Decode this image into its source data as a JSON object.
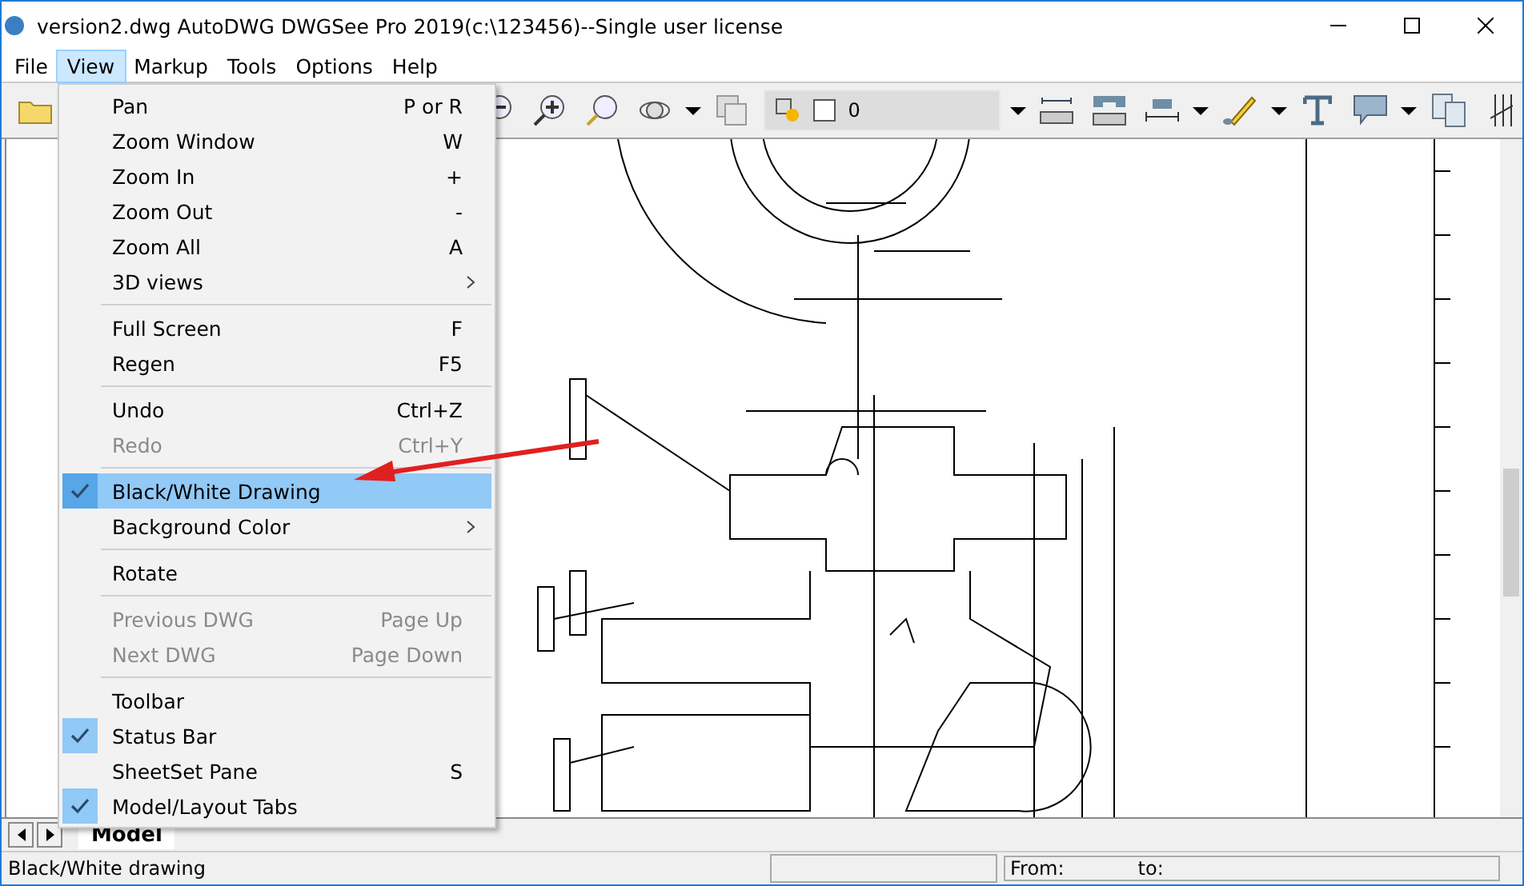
{
  "window": {
    "title": "version2.dwg AutoDWG DWGSee Pro 2019(c:\\123456)--Single user license"
  },
  "menu_bar": [
    {
      "label": "File",
      "selected": false
    },
    {
      "label": "View",
      "selected": true
    },
    {
      "label": "Markup",
      "selected": false
    },
    {
      "label": "Tools",
      "selected": false
    },
    {
      "label": "Options",
      "selected": false
    },
    {
      "label": "Help",
      "selected": false
    }
  ],
  "layer_dropdown": {
    "value": "0"
  },
  "view_menu": [
    {
      "kind": "item",
      "label": "Pan",
      "shortcut": "P or R",
      "disabled": false,
      "checked": false,
      "selected": false
    },
    {
      "kind": "item",
      "label": "Zoom Window",
      "shortcut": "W",
      "disabled": false,
      "checked": false,
      "selected": false
    },
    {
      "kind": "item",
      "label": "Zoom In",
      "shortcut": "+",
      "disabled": false,
      "checked": false,
      "selected": false
    },
    {
      "kind": "item",
      "label": "Zoom Out",
      "shortcut": "-",
      "disabled": false,
      "checked": false,
      "selected": false
    },
    {
      "kind": "item",
      "label": "Zoom All",
      "shortcut": "A",
      "disabled": false,
      "checked": false,
      "selected": false
    },
    {
      "kind": "submenu",
      "label": "3D views",
      "disabled": false,
      "checked": false,
      "selected": false
    },
    {
      "kind": "separator"
    },
    {
      "kind": "item",
      "label": "Full Screen",
      "shortcut": "F",
      "disabled": false,
      "checked": false,
      "selected": false
    },
    {
      "kind": "item",
      "label": "Regen",
      "shortcut": "F5",
      "disabled": false,
      "checked": false,
      "selected": false
    },
    {
      "kind": "separator"
    },
    {
      "kind": "item",
      "label": "Undo",
      "shortcut": "Ctrl+Z",
      "disabled": false,
      "checked": false,
      "selected": false
    },
    {
      "kind": "item",
      "label": "Redo",
      "shortcut": "Ctrl+Y",
      "disabled": true,
      "checked": false,
      "selected": false
    },
    {
      "kind": "separator"
    },
    {
      "kind": "item",
      "label": "Black/White Drawing",
      "disabled": false,
      "checked": true,
      "selected": true
    },
    {
      "kind": "submenu",
      "label": "Background Color",
      "disabled": false,
      "checked": false,
      "selected": false
    },
    {
      "kind": "separator"
    },
    {
      "kind": "item",
      "label": "Rotate",
      "disabled": false,
      "checked": false,
      "selected": false
    },
    {
      "kind": "separator"
    },
    {
      "kind": "item",
      "label": "Previous DWG",
      "shortcut": "Page Up",
      "disabled": true,
      "checked": false,
      "selected": false
    },
    {
      "kind": "item",
      "label": "Next DWG",
      "shortcut": "Page Down",
      "disabled": true,
      "checked": false,
      "selected": false
    },
    {
      "kind": "separator"
    },
    {
      "kind": "item",
      "label": "Toolbar",
      "disabled": false,
      "checked": false,
      "selected": false
    },
    {
      "kind": "item",
      "label": "Status Bar",
      "disabled": false,
      "checked": true,
      "selected": false
    },
    {
      "kind": "item",
      "label": "SheetSet Pane",
      "shortcut": "S",
      "disabled": false,
      "checked": false,
      "selected": false
    },
    {
      "kind": "item",
      "label": "Model/Layout Tabs",
      "disabled": false,
      "checked": true,
      "selected": false
    }
  ],
  "sheet_tabs": [
    {
      "label": "Model",
      "selected": true
    }
  ],
  "status_bar": {
    "message": "Black/White drawing",
    "from_label": "From:",
    "to_label": "to:"
  }
}
